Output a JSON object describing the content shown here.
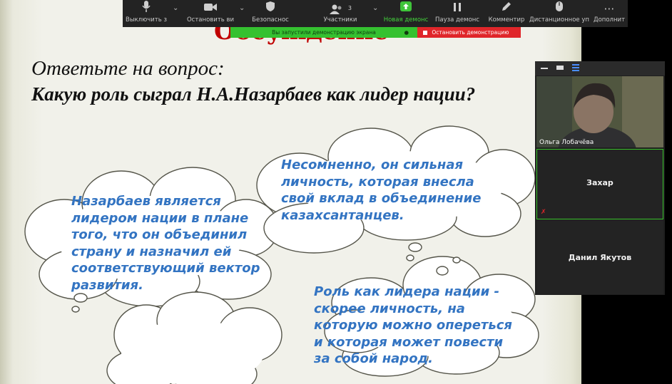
{
  "toolbar": {
    "mute": "Выключить з",
    "stop_video": "Остановить ви",
    "security": "Безопаснос",
    "participants": "Участники",
    "participants_count": "3",
    "new_share": "Новая демонс",
    "pause_share": "Пауза демонс",
    "annotate": "Комментир",
    "remote_control": "Дистанционное уп",
    "more": "Дополнит"
  },
  "share_bar": {
    "status": "Вы запустили демонстрацию экрана",
    "stop": "Остановить демонстрацию"
  },
  "slide": {
    "title": "Обсуждение",
    "question_lead": "Ответьте на вопрос:",
    "question": "Какую роль сыграл Н.А.Назарбаев как лидер нации?",
    "answer_1": "Назарбаев является\nлидером нации в плане\nтого, что он объединил\nстрану и назначил ей\nсоответствующий вектор\nразвития.",
    "answer_2": "Несомненно, он сильная\nличность, которая внесла\nсвой вклад в объединение\nказахсантанцев.",
    "answer_3": "Роль как лидера нации -\nскорее личность, на\nкоторую можно опереться\nи которая может повести\nза собой народ."
  },
  "participants": {
    "olga": "Ольга Лобачёва",
    "zahar": "Захар",
    "daniil": "Данил Якутов"
  },
  "colors": {
    "answer_text": "#3374c2",
    "title_red": "#c00000",
    "share_green": "#35c130",
    "stop_red": "#e0262a",
    "toolbar_bg": "#232323"
  }
}
